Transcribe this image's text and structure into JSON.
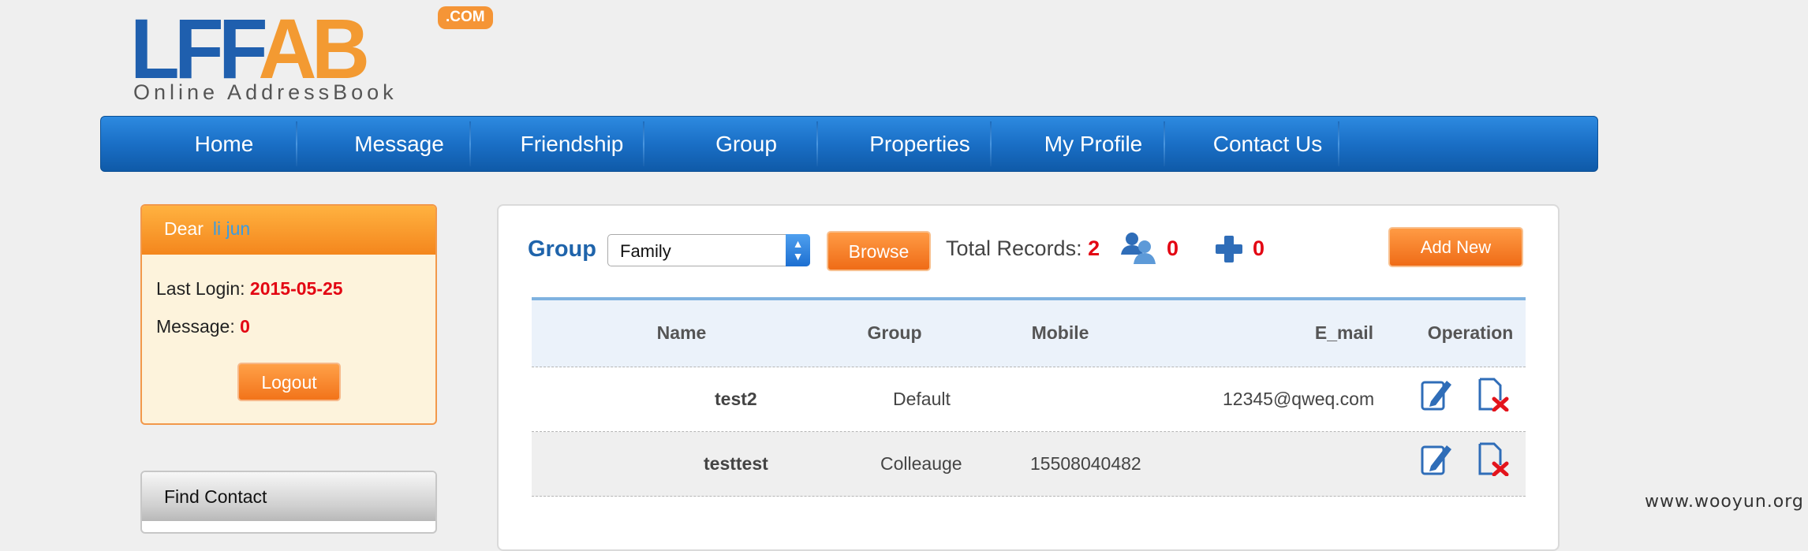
{
  "logo": {
    "letters_blue": "LFF",
    "letters_orange": "AB",
    "com": ".COM",
    "tagline": "Online AddressBook"
  },
  "nav": {
    "items": [
      "Home",
      "Message",
      "Friendship",
      "Group",
      "Properties",
      "My Profile",
      "Contact Us"
    ]
  },
  "user": {
    "greeting": "Dear",
    "name": "li jun",
    "last_login_label": "Last Login:",
    "last_login_value": "2015-05-25",
    "message_label": "Message:",
    "message_value": "0",
    "logout_label": "Logout"
  },
  "find": {
    "title": "Find Contact"
  },
  "toolbar": {
    "group_label": "Group",
    "group_selected": "Family",
    "browse_label": "Browse",
    "total_label": "Total Records:",
    "total_value": "2",
    "users_count": "0",
    "plus_count": "0",
    "add_label": "Add New"
  },
  "table": {
    "headers": [
      "Name",
      "Group",
      "Mobile",
      "E_mail",
      "Operation"
    ],
    "rows": [
      {
        "name": "test2",
        "group": "Default",
        "mobile": "",
        "email": "12345@qweq.com"
      },
      {
        "name": "testtest",
        "group": "Colleauge",
        "mobile": "15508040482",
        "email": ""
      }
    ]
  },
  "watermark": "www.wooyun.org",
  "colors": {
    "nav_blue": "#1a6fc6",
    "accent_orange": "#f2741a",
    "value_red": "#e30613",
    "label_blue": "#1f64ab"
  }
}
